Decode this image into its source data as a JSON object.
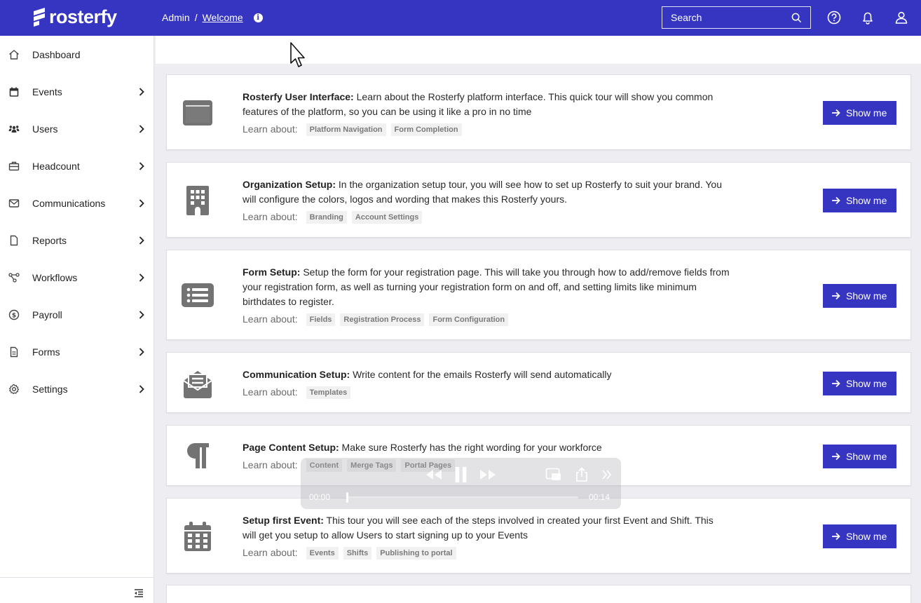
{
  "app": {
    "brand": "rosterfy"
  },
  "header": {
    "breadcrumb": [
      "Admin",
      "Welcome"
    ],
    "info_glyph": "i",
    "search_placeholder": "Search"
  },
  "sidebar": {
    "items": [
      {
        "label": "Dashboard",
        "icon": "home-icon"
      },
      {
        "label": "Events",
        "icon": "calendar-icon"
      },
      {
        "label": "Users",
        "icon": "users-icon"
      },
      {
        "label": "Headcount",
        "icon": "briefcase-icon"
      },
      {
        "label": "Communications",
        "icon": "envelope-icon"
      },
      {
        "label": "Reports",
        "icon": "file-icon"
      },
      {
        "label": "Workflows",
        "icon": "workflow-icon"
      },
      {
        "label": "Payroll",
        "icon": "dollar-icon"
      },
      {
        "label": "Forms",
        "icon": "form-icon"
      },
      {
        "label": "Settings",
        "icon": "gear-icon"
      }
    ]
  },
  "tours": {
    "learn_label": "Learn about:",
    "button_label": "Show me",
    "cards": [
      {
        "title": "Rosterfy User Interface:",
        "text": " Learn about the Rosterfy platform interface. This quick tour will show you common features of the platform, so you can be using it like a pro in no time",
        "tags": [
          "Platform Navigation",
          "Form Completion"
        ],
        "icon": "window-icon"
      },
      {
        "title": "Organization Setup:",
        "text": " In the organization setup tour, you will see how to set up Rosterfy to suit your brand. You will configure the colors, logos and wording that makes this Rosterfy yours.",
        "tags": [
          "Branding",
          "Account Settings"
        ],
        "icon": "building-icon"
      },
      {
        "title": "Form Setup:",
        "text": " Setup the form for your registration page. This will take you through how to add/remove fields from your registration form, as well as turning your registration form on and off, and setting limits like minimum birthdates to register.",
        "tags": [
          "Fields",
          "Registration Process",
          "Form Configuration"
        ],
        "icon": "list-icon"
      },
      {
        "title": "Communication Setup:",
        "text": " Write content for the emails Rosterfy will send automatically",
        "tags": [
          "Templates"
        ],
        "icon": "envelope-open-icon"
      },
      {
        "title": "Page Content Setup:",
        "text": " Make sure Rosterfy has the right wording for your workforce",
        "tags": [
          "Content",
          "Merge Tags",
          "Portal Pages"
        ],
        "icon": "paragraph-icon"
      },
      {
        "title": "Setup first Event:",
        "text": " This tour you will see each of the steps involved in created your first Event and Shift. This will get you setup to allow Users to start signing up to your Events",
        "tags": [
          "Events",
          "Shifts",
          "Publishing to portal"
        ],
        "icon": "calendar-grid-icon"
      }
    ]
  },
  "video": {
    "current_time": "00:00",
    "duration": "00:14",
    "progress": 0.0
  },
  "colors": {
    "brand": "#3535c2",
    "icon_gray": "#737373"
  }
}
